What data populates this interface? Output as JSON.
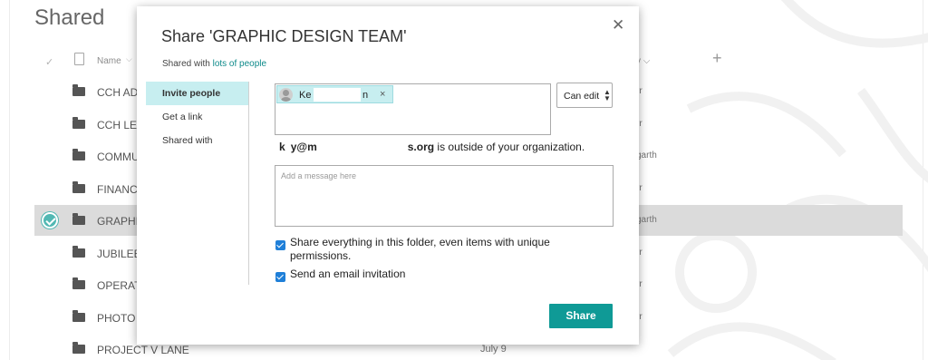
{
  "page": {
    "title": "Shared",
    "columns": {
      "name": "Name",
      "modified_by_suffix": "y"
    },
    "rows": [
      {
        "name": "CCH AD",
        "modified": "",
        "by": "rr",
        "selected": false
      },
      {
        "name": "CCH LE",
        "modified": "",
        "by": "rr",
        "selected": false
      },
      {
        "name": "COMMU",
        "modified": "",
        "by": "garth",
        "selected": false
      },
      {
        "name": "FINANC",
        "modified": "",
        "by": "rr",
        "selected": false
      },
      {
        "name": "GRAPHI",
        "modified": "",
        "by": "garth",
        "selected": true
      },
      {
        "name": "JUBILEE",
        "modified": "",
        "by": "rr",
        "selected": false
      },
      {
        "name": "OPERAT",
        "modified": "",
        "by": "rr",
        "selected": false
      },
      {
        "name": "PHOTO",
        "modified": "",
        "by": "rr",
        "selected": false
      },
      {
        "name": "PROJECT V        LANE",
        "modified": "July 9",
        "by": "",
        "selected": false
      }
    ]
  },
  "dialog": {
    "title": "Share 'GRAPHIC DESIGN TEAM'",
    "close_glyph": "✕",
    "shared_with_prefix": "Shared with ",
    "shared_with_link": "lots of people",
    "nav": [
      "Invite people",
      "Get a link",
      "Shared with"
    ],
    "recipient": {
      "name_start": "Ke",
      "name_end": "n",
      "remove_glyph": "×"
    },
    "permission": "Can edit",
    "outside": {
      "email_part1": "k",
      "email_part2": "y@m",
      "email_part3": "s.org",
      "message": " is outside of your organization."
    },
    "message_placeholder": "Add a message here",
    "checkboxes": [
      {
        "label": "Share everything in this folder, even items with unique permissions.",
        "checked": true
      },
      {
        "label": "Send an email invitation",
        "checked": true
      }
    ],
    "share_button": "Share"
  },
  "colors": {
    "accent": "#0f9a96",
    "selected_row": "#cfcfcf",
    "nav_active": "#c7eef0",
    "checkbox": "#1f7fd8"
  }
}
